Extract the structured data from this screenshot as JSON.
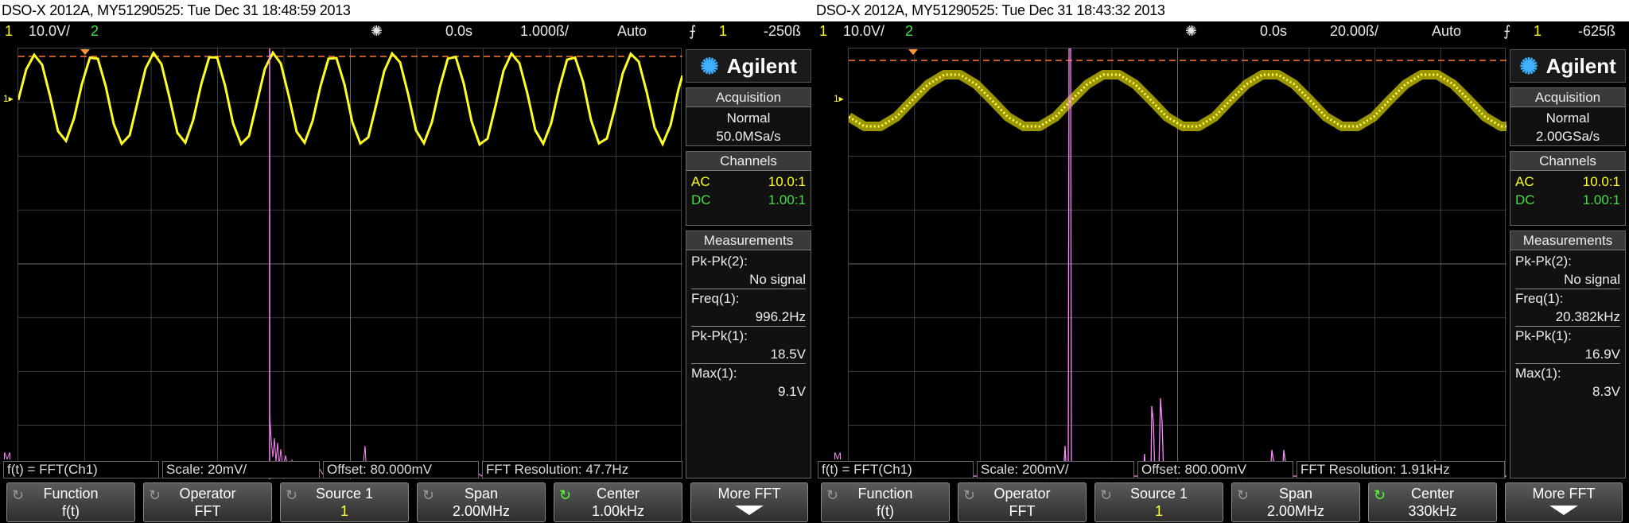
{
  "screens": [
    {
      "title": "DSO-X 2012A, MY51290525: Tue Dec 31 18:48:59 2013",
      "topbar": {
        "ch1_num": "1",
        "ch1_scale": "10.0V/",
        "ch2_num": "2",
        "time_offset": "0.0s",
        "time_scale": "1.000ß/",
        "trigger_mode": "Auto",
        "trig_ch": "1",
        "trig_level": "-250ß"
      },
      "logo": "Agilent",
      "acquisition": {
        "header": "Acquisition",
        "mode": "Normal",
        "rate": "50.0MSa/s"
      },
      "channels": {
        "header": "Channels",
        "ch1_coupling": "AC",
        "ch1_probe": "10.0:1",
        "ch2_coupling": "DC",
        "ch2_probe": "1.00:1"
      },
      "measurements": {
        "header": "Measurements",
        "items": [
          {
            "label": "Pk-Pk(2):",
            "value": "No signal"
          },
          {
            "label": "Freq(1):",
            "value": "996.2Hz"
          },
          {
            "label": "Pk-Pk(1):",
            "value": "18.5V"
          },
          {
            "label": "Max(1):",
            "value": "9.1V"
          }
        ]
      },
      "fft_bar": {
        "func": "f(t) = FFT(Ch1)",
        "scale": "Scale: 20mV/",
        "offset": "Offset: 80.000mV",
        "resolution": "FFT Resolution: 47.7Hz"
      },
      "softkeys": [
        {
          "label": "Function",
          "value": "f(t)"
        },
        {
          "label": "Operator",
          "value": "FFT"
        },
        {
          "label": "Source 1",
          "value": "1"
        },
        {
          "label": "Span",
          "value": "2.00MHz"
        },
        {
          "label": "Center",
          "value": "1.00kHz"
        },
        {
          "label": "More FFT",
          "value": ""
        }
      ],
      "colors": {
        "ch1": "#ffff22",
        "ch2": "#44dd44",
        "math": "#ff88ff",
        "trigger_line": "#ff7733"
      }
    },
    {
      "title": "DSO-X 2012A, MY51290525: Tue Dec 31 18:43:32 2013",
      "topbar": {
        "ch1_num": "1",
        "ch1_scale": "10.0V/",
        "ch2_num": "2",
        "time_offset": "0.0s",
        "time_scale": "20.00ß/",
        "trigger_mode": "Auto",
        "trig_ch": "1",
        "trig_level": "-625ß"
      },
      "logo": "Agilent",
      "acquisition": {
        "header": "Acquisition",
        "mode": "Normal",
        "rate": "2.00GSa/s"
      },
      "channels": {
        "header": "Channels",
        "ch1_coupling": "AC",
        "ch1_probe": "10.0:1",
        "ch2_coupling": "DC",
        "ch2_probe": "1.00:1"
      },
      "measurements": {
        "header": "Measurements",
        "items": [
          {
            "label": "Pk-Pk(2):",
            "value": "No signal"
          },
          {
            "label": "Freq(1):",
            "value": "20.382kHz"
          },
          {
            "label": "Pk-Pk(1):",
            "value": "16.9V"
          },
          {
            "label": "Max(1):",
            "value": "8.3V"
          }
        ]
      },
      "fft_bar": {
        "func": "f(t) = FFT(Ch1)",
        "scale": "Scale: 200mV/",
        "offset": "Offset: 800.00mV",
        "resolution": "FFT Resolution: 1.91kHz"
      },
      "softkeys": [
        {
          "label": "Function",
          "value": "f(t)"
        },
        {
          "label": "Operator",
          "value": "FFT"
        },
        {
          "label": "Source 1",
          "value": "1"
        },
        {
          "label": "Span",
          "value": "2.00MHz"
        },
        {
          "label": "Center",
          "value": "330kHz"
        },
        {
          "label": "More FFT",
          "value": ""
        }
      ],
      "colors": {
        "ch1": "#ffff22",
        "ch2": "#44dd44",
        "math": "#ff88ff",
        "trigger_line": "#ff7733"
      }
    }
  ]
}
